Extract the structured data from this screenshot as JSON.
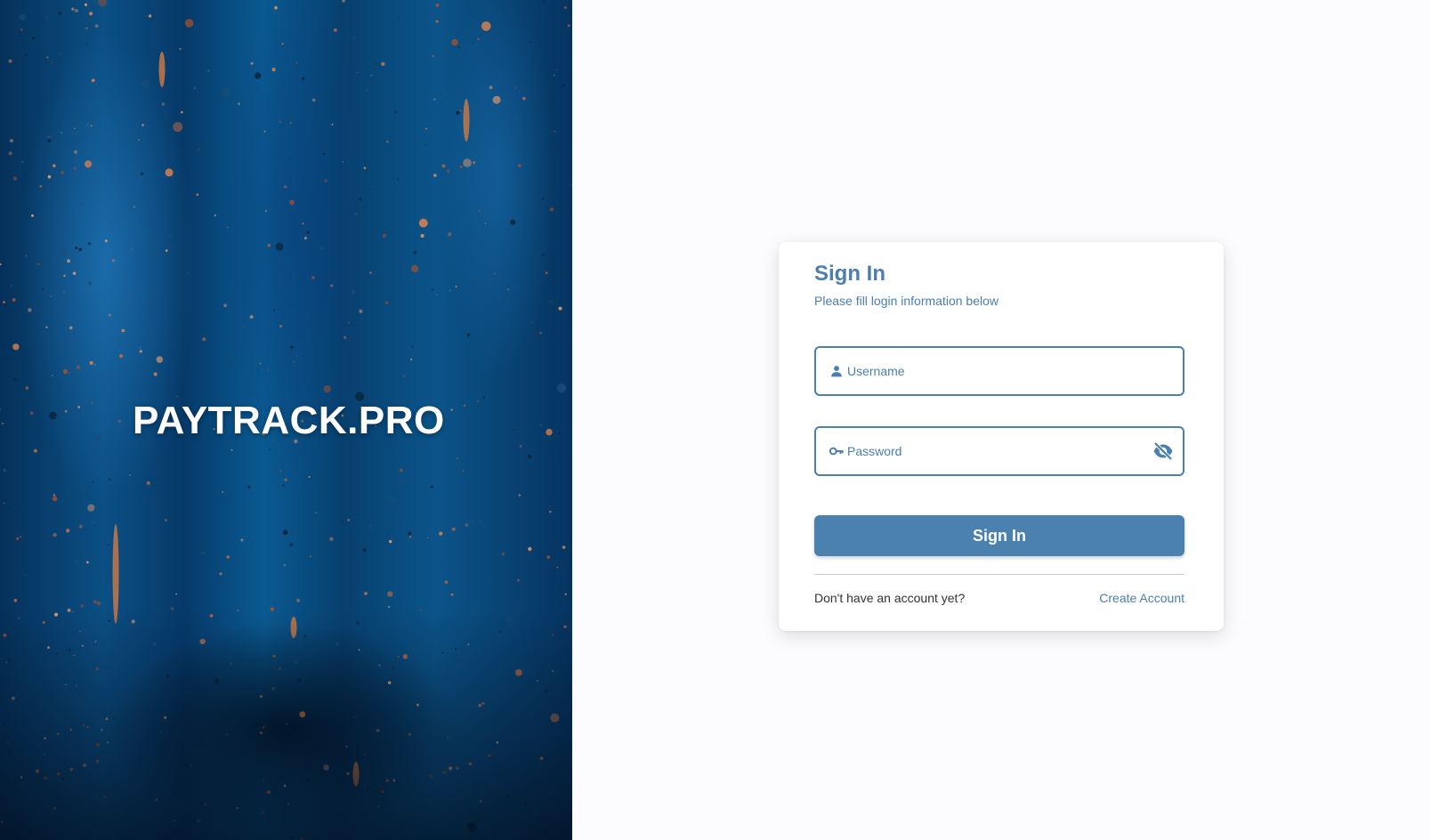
{
  "brand": {
    "name": "PAYTRACK.PRO"
  },
  "login_card": {
    "title": "Sign In",
    "subtitle": "Please fill login information below",
    "username": {
      "placeholder": "Username",
      "value": "",
      "icon": "person-icon"
    },
    "password": {
      "placeholder": "Password",
      "value": "",
      "icon": "key-icon",
      "toggle_icon": "eye-off-icon"
    },
    "submit_label": "Sign In",
    "footer_text": "Don't have an account yet?",
    "create_account_label": "Create Account"
  },
  "colors": {
    "accent": "#4a7fae",
    "button": "#4a81af",
    "hero_dark": "#063460",
    "hero_light": "#0b5489"
  }
}
